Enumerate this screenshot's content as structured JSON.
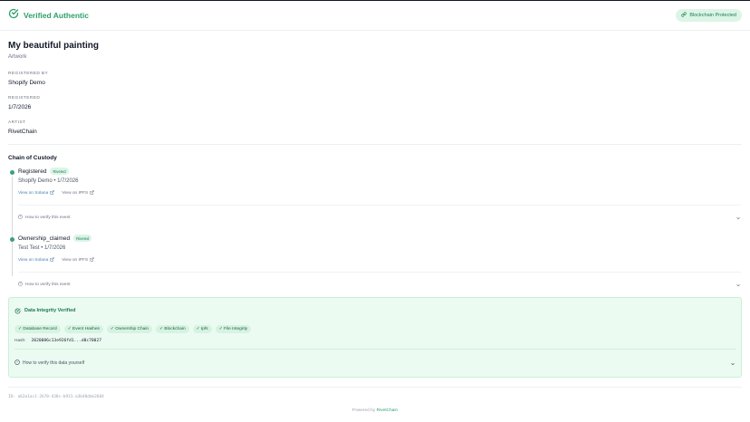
{
  "header": {
    "title": "Verified Authentic",
    "badge": "Blockchain Protected"
  },
  "item": {
    "title": "My beautiful painting",
    "category": "Artwork",
    "fields": [
      {
        "label": "REGISTERED BY",
        "value": "Shopify Demo"
      },
      {
        "label": "REGISTERED",
        "value": "1/7/2026"
      },
      {
        "label": "ARTIST",
        "value": "RivetChain"
      }
    ]
  },
  "custody": {
    "title": "Chain of Custody",
    "events": [
      {
        "name": "Registered",
        "badge": "Riveted",
        "subtitle": "Shopify Demo • 1/7/2026",
        "link_solana": "View on Solana",
        "link_ipfs": "View on IPFS",
        "verify": "How to verify this event"
      },
      {
        "name": "Ownership_claimed",
        "badge": "Riveted",
        "subtitle": "Test Test • 1/7/2026",
        "link_solana": "View on Solana",
        "link_ipfs": "View on IPFS",
        "verify": "How to verify this event"
      }
    ]
  },
  "integrity": {
    "title": "Data Integrity Verified",
    "chips": [
      "✓ Database Record",
      "✓ Event Hashes",
      "✓ Ownership Chain",
      "✓ Blockchain",
      "✓ Ipfs",
      "✓ File Integrity"
    ],
    "hash_label": "Hash:",
    "hash_value": "2020086c13e926fd1...d8c70027",
    "verify_self": "How to verify this data yourself"
  },
  "id_text": "ID: a63a1ac1-2b70-438c-b931-a3b48dde2684",
  "footer": {
    "prefix": "Powered by",
    "brand": "RivetChain"
  },
  "colors": {
    "accent": "#2e9e6b",
    "badge_bg": "#dcf5e7",
    "panel_bg": "#ecfbf2"
  }
}
